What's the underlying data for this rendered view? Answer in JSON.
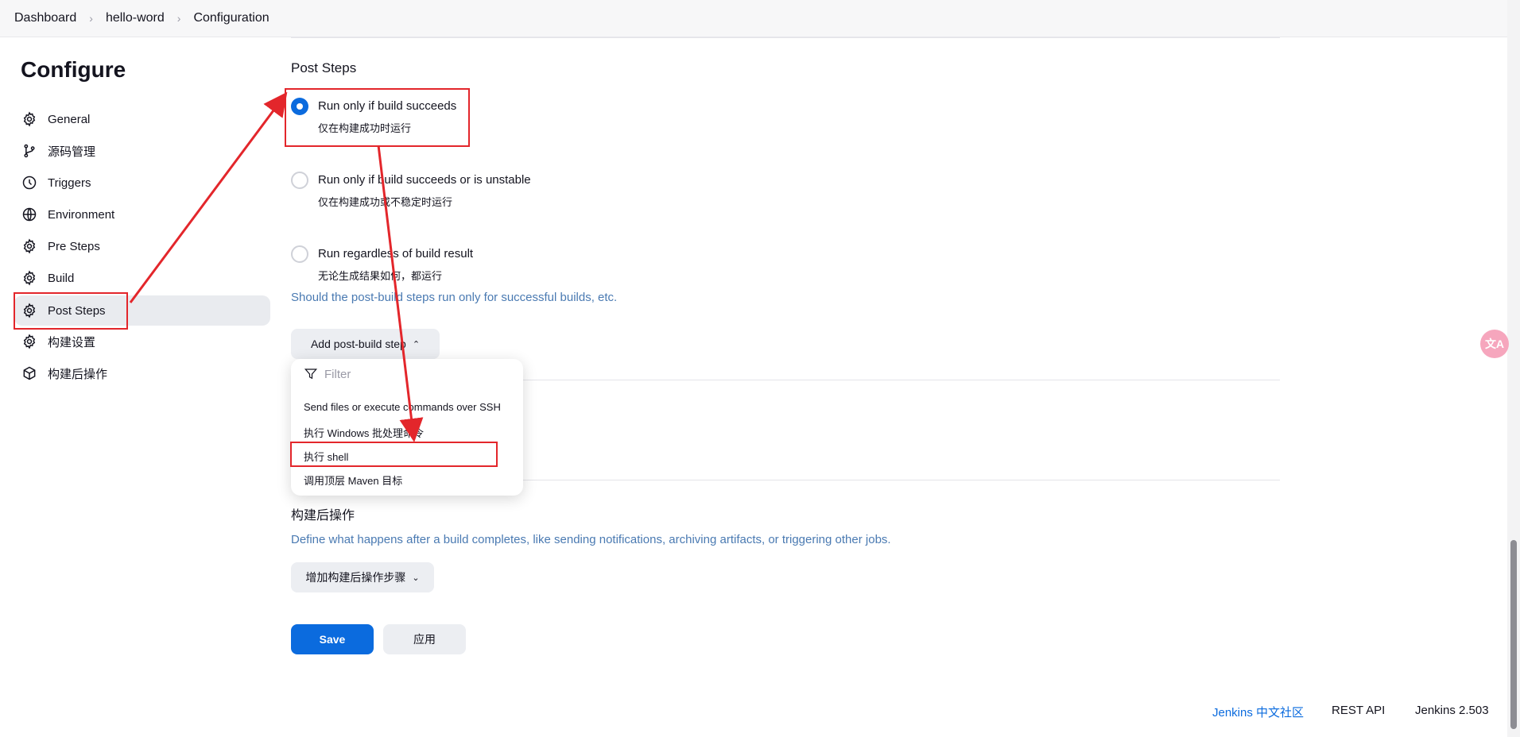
{
  "breadcrumb": [
    "Dashboard",
    "hello-word",
    "Configuration"
  ],
  "sidebar": {
    "title": "Configure",
    "items": [
      {
        "label": "General",
        "icon": "gear-icon"
      },
      {
        "label": "源码管理",
        "icon": "branch-icon"
      },
      {
        "label": "Triggers",
        "icon": "clock-icon"
      },
      {
        "label": "Environment",
        "icon": "globe-icon"
      },
      {
        "label": "Pre Steps",
        "icon": "gear-icon"
      },
      {
        "label": "Build",
        "icon": "gear-icon"
      },
      {
        "label": "Post Steps",
        "icon": "gear-icon",
        "active": true
      },
      {
        "label": "构建设置",
        "icon": "gear-icon"
      },
      {
        "label": "构建后操作",
        "icon": "cube-icon"
      }
    ]
  },
  "post_steps": {
    "title": "Post Steps",
    "options": [
      {
        "label": "Run only if build succeeds",
        "sub": "仅在构建成功时运行",
        "checked": true
      },
      {
        "label": "Run only if build succeeds or is unstable",
        "sub": "仅在构建成功或不稳定时运行",
        "checked": false
      },
      {
        "label": "Run regardless of build result",
        "sub": "无论生成结果如何，都运行",
        "checked": false
      }
    ],
    "help": "Should the post-build steps run only for successful builds, etc.",
    "add_button": "Add post-build step",
    "add_button_chevron": "chevron-up-icon"
  },
  "dropdown": {
    "filter_placeholder": "Filter",
    "items": [
      "Send files or execute commands over SSH",
      "执行 Windows 批处理命令",
      "执行 shell",
      "调用顶层 Maven 目标"
    ]
  },
  "post_build": {
    "title": "构建后操作",
    "help": "Define what happens after a build completes, like sending notifications, archiving artifacts, or triggering other jobs.",
    "add_button": "增加构建后操作步骤",
    "add_button_chevron": "chevron-down-icon"
  },
  "actions": {
    "save": "Save",
    "apply": "应用"
  },
  "footer": {
    "community": "Jenkins 中文社区",
    "rest_api": "REST API",
    "version": "Jenkins 2.503"
  },
  "translate_badge": "文A",
  "colors": {
    "accent": "#0b6bde",
    "annotation": "#e3262b",
    "help_text": "#4a7ab2"
  }
}
